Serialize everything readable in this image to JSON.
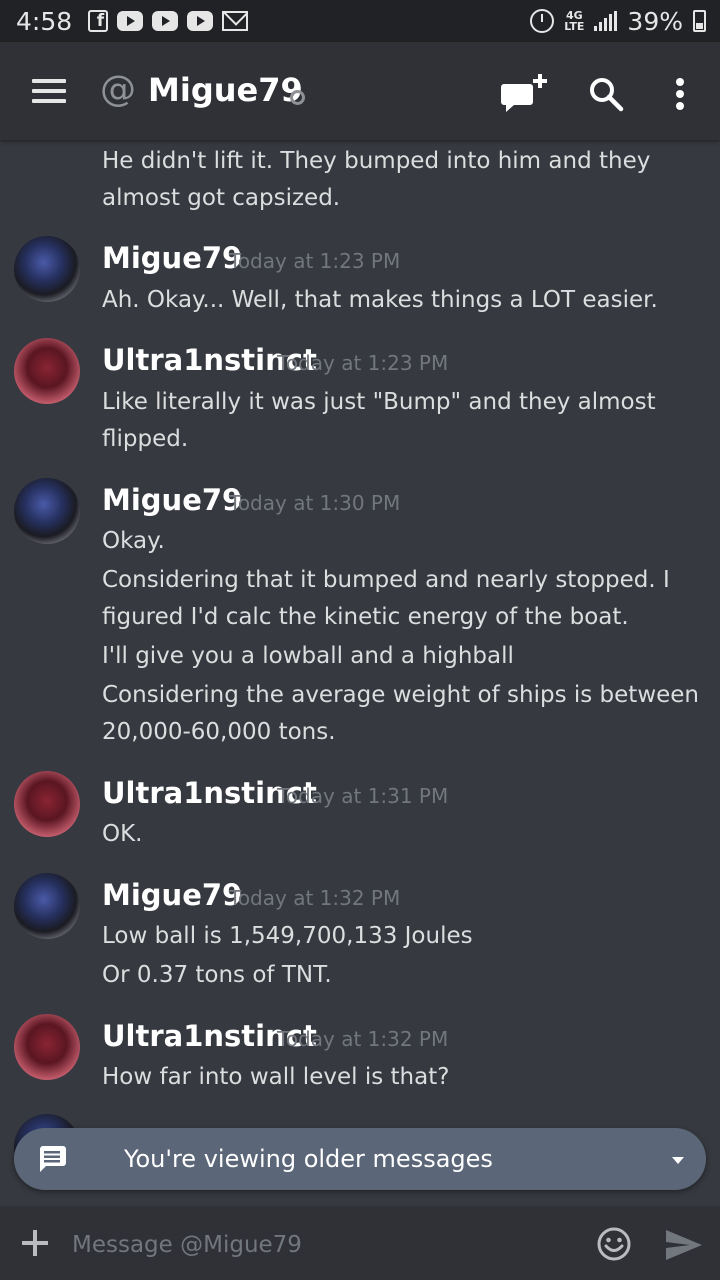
{
  "status_bar": {
    "time": "4:58",
    "network": "4G",
    "network_sub": "LTE",
    "battery": "39%"
  },
  "header": {
    "at_symbol": "@",
    "title": "Migue79"
  },
  "messages": {
    "partial_first_line1": "He didn't lift it. They bumped into him and they",
    "partial_first_line2": "almost got capsized.",
    "g1": {
      "author": "Migue79",
      "time": "Today at 1:23 PM",
      "lines": [
        "Ah. Okay... Well, that makes things a LOT easier."
      ]
    },
    "g2": {
      "author": "Ultra1nstinct",
      "time": "Today at 1:23 PM",
      "lines": [
        "Like literally it was just \"Bump\" and they almost",
        "flipped."
      ]
    },
    "g3": {
      "author": "Migue79",
      "time": "Today at 1:30 PM",
      "lines": [
        "Okay.",
        "Considering that it bumped and nearly stopped. I",
        "figured I'd calc the kinetic energy of the boat.",
        "I'll give you a lowball and a highball",
        "Considering the average weight of ships is between",
        "20,000-60,000 tons."
      ]
    },
    "g4": {
      "author": "Ultra1nstinct",
      "time": "Today at 1:31 PM",
      "lines": [
        "OK."
      ]
    },
    "g5": {
      "author": "Migue79",
      "time": "Today at 1:32 PM",
      "lines": [
        "Low ball is 1,549,700,133 Joules",
        "Or 0.37 tons of TNT."
      ]
    },
    "g6": {
      "author": "Ultra1nstinct",
      "time": "Today at 1:32 PM",
      "lines": [
        "How far into wall level is that?"
      ]
    }
  },
  "older_bar": {
    "label": "You're viewing older messages"
  },
  "composer": {
    "placeholder": "Message @Migue79"
  },
  "colors": {
    "background": "#36393f",
    "header_bg": "#2f3136",
    "older_bar_bg": "#5b6778",
    "timestamp": "#72767d"
  }
}
